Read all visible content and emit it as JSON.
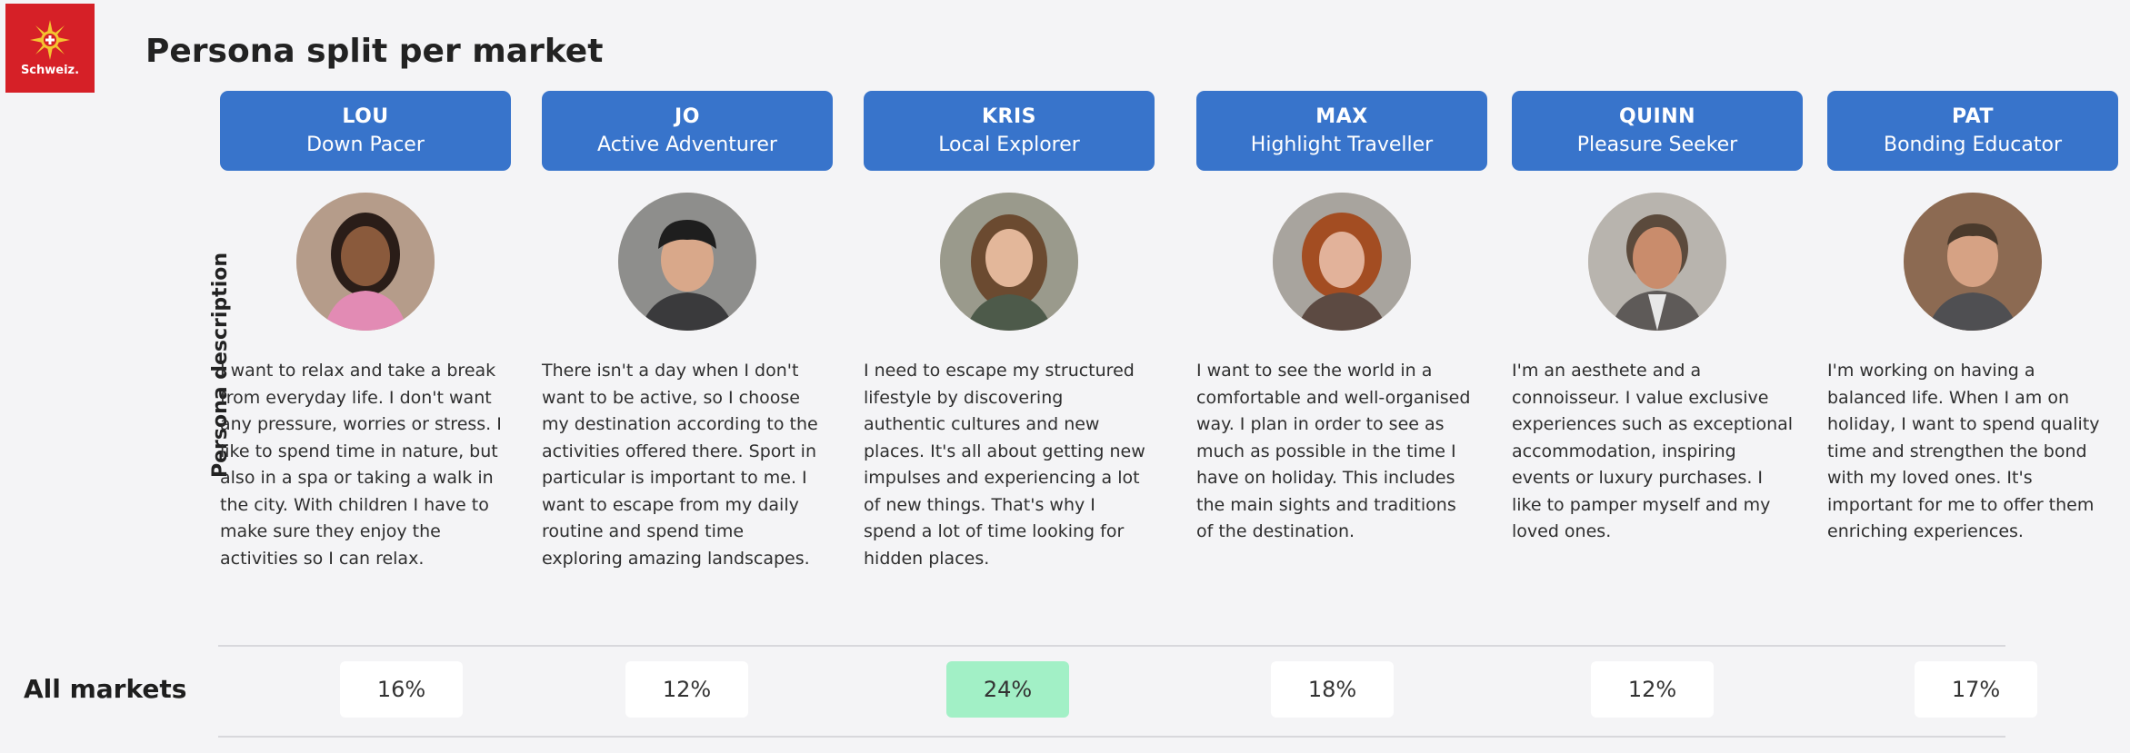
{
  "logo": {
    "text": "Schweiz.",
    "color": "#d62027"
  },
  "page_title": "Persona split per market",
  "side_label": "Persona description",
  "row_label": "All markets",
  "accent_color": "#3874cb",
  "highlight_color": "#a2f0c6",
  "personas": [
    {
      "name": "LOU",
      "type": "Down Pacer",
      "description": "I want to relax and take a break from everyday life. I don't want any pressure, worries or stress. I like to spend time in nature, but also in a spa or taking a walk in the city. With children I have to make sure they enjoy the activities so I can relax.",
      "share": "16%",
      "highlight": false
    },
    {
      "name": "JO",
      "type": "Active Adventurer",
      "description": "There isn't a day when I don't want to be active, so I choose my destination according to the activities offered there. Sport in particular is important to me. I want to escape from my daily routine and spend time exploring amazing landscapes.",
      "share": "12%",
      "highlight": false
    },
    {
      "name": "KRIS",
      "type": "Local Explorer",
      "description": "I need to escape my structured lifestyle by discovering authentic cultures and new places. It's all about getting new impulses and experiencing a lot of new things. That's why I spend a lot of time looking for hidden places.",
      "share": "24%",
      "highlight": true
    },
    {
      "name": "MAX",
      "type": "Highlight Traveller",
      "description": "I want to see the world in a comfortable and well-organised way. I plan in order to see as much as possible in the time I have on holiday. This includes the main sights and traditions of the destination.",
      "share": "18%",
      "highlight": false
    },
    {
      "name": "QUINN",
      "type": "Pleasure Seeker",
      "description": "I'm an aesthete and a connoisseur. I value exclusive experiences such as exceptional accommodation, inspiring events or luxury purchases. I like to pamper myself and my loved ones.",
      "share": "12%",
      "highlight": false
    },
    {
      "name": "PAT",
      "type": "Bonding Educator",
      "description": "I'm working on having a balanced life. When I am on holiday, I want to spend quality time and strengthen the bond with my loved ones. It's important for me to offer them enriching experiences.",
      "share": "17%",
      "highlight": false
    }
  ]
}
